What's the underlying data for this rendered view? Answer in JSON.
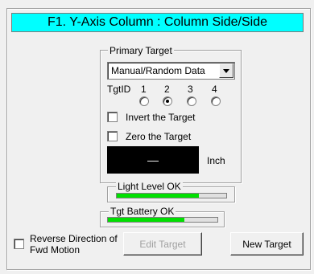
{
  "title": "F1. Y-Axis Column : Column Side/Side",
  "primary_target": {
    "group_label": "Primary Target",
    "select_value": "Manual/Random Data",
    "tgtid_label": "TgtID",
    "radio_numbers": [
      "1",
      "2",
      "3",
      "4"
    ],
    "selected_radio": "2",
    "invert_label": "Invert the Target",
    "zero_label": "Zero the Target",
    "display_value": "—",
    "unit_label": "Inch"
  },
  "light_level": {
    "label": "Light Level OK",
    "fill_percent": 75
  },
  "tgt_battery": {
    "label": "Tgt Battery OK",
    "fill_percent": 70
  },
  "reverse_label": "Reverse Direction of Fwd Motion",
  "edit_button": "Edit Target",
  "new_button": "New Target",
  "colors": {
    "title_bg": "#00ffff",
    "meter_fill": "#00e000"
  }
}
